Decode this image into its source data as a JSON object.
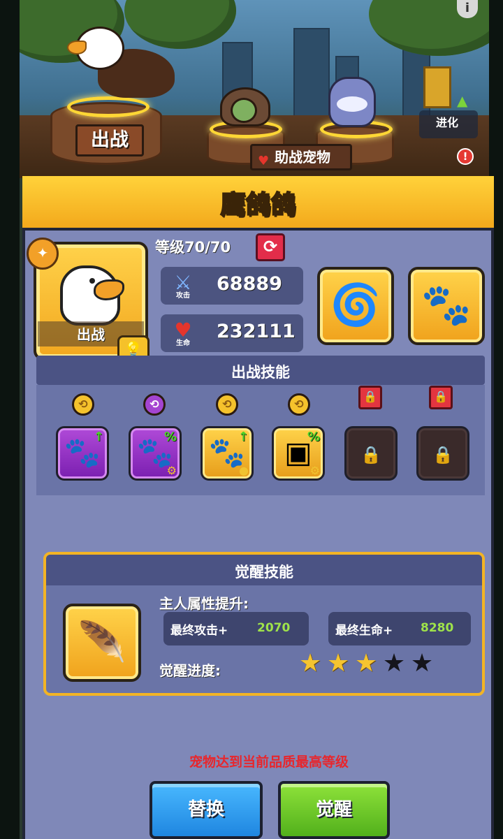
{
  "scene": {
    "deploy_sign": "出战",
    "assist_label": "助战宠物",
    "evolve_label": "进化",
    "info_glyph": "i",
    "alert_glyph": "!"
  },
  "panel": {
    "title": "鹰鸽鸽",
    "portrait_label": "出战",
    "level": "等级70/70",
    "attack_caption": "攻击",
    "attack_value": "68889",
    "hp_caption": "生命",
    "hp_value": "232111",
    "battle_skills_title": "出战技能"
  },
  "skills": [
    {
      "type": "purple",
      "badge": "gold",
      "glyph": "🐾",
      "mark": "↑"
    },
    {
      "type": "purple",
      "badge": "purple",
      "glyph": "🐾",
      "mark": "%"
    },
    {
      "type": "gold",
      "badge": "gold",
      "glyph": "🐾",
      "mark": "↑"
    },
    {
      "type": "gold",
      "badge": "gold",
      "glyph": "▣",
      "mark": "%"
    },
    {
      "type": "locked",
      "badge": "lock",
      "glyph": "🔒",
      "mark": ""
    },
    {
      "type": "locked",
      "badge": "lock",
      "glyph": "🔒",
      "mark": ""
    }
  ],
  "awakening": {
    "title": "觉醒技能",
    "owner_label": "主人属性提升:",
    "atk_label": "最终攻击+",
    "atk_value": "2070",
    "hp_label": "最终生命+",
    "hp_value": "8280",
    "progress_label": "觉醒进度:",
    "stars_filled": 3,
    "stars_total": 5
  },
  "footer": {
    "notice": "宠物达到当前品质最高等级",
    "replace_button": "替换",
    "awaken_button": "觉醒"
  },
  "colors": {
    "gold": "#f5c430",
    "panel": "#7f88b8",
    "notice_red": "#e8262c",
    "bonus_green": "#9fe34a"
  }
}
